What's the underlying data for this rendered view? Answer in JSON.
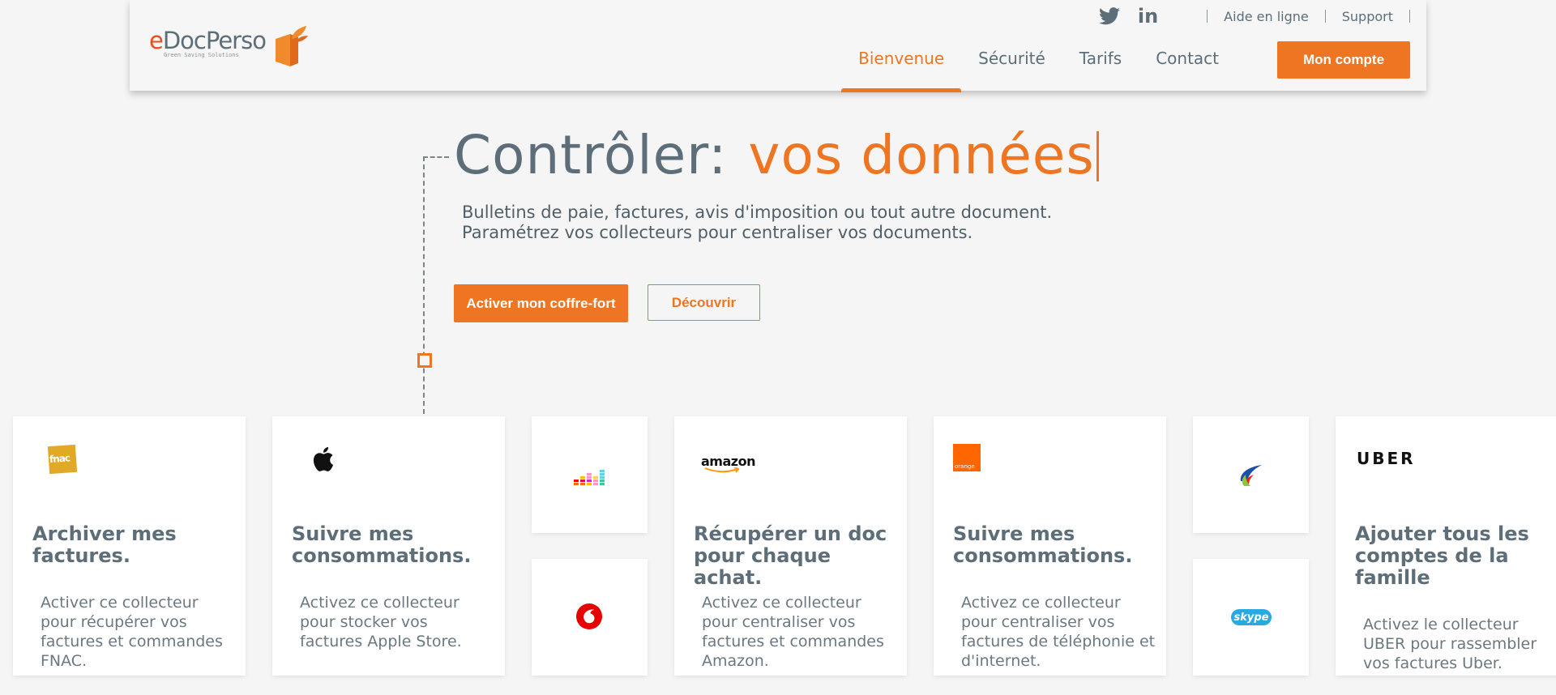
{
  "header": {
    "logo": {
      "text": "eDocPerso",
      "tagline": "Green Saving Solutions"
    },
    "social": [
      {
        "name": "twitter-icon"
      },
      {
        "name": "linkedin-icon",
        "label": "in"
      }
    ],
    "top_links": {
      "help": "Aide en ligne",
      "support": "Support"
    },
    "nav": [
      {
        "label": "Bienvenue",
        "active": true
      },
      {
        "label": "Sécurité",
        "active": false
      },
      {
        "label": "Tarifs",
        "active": false
      },
      {
        "label": "Contact",
        "active": false
      }
    ],
    "account_label": "Mon compte"
  },
  "hero": {
    "title_static": "Contrôler:",
    "title_dynamic": "vos données",
    "subtitle_line1": "Bulletins de paie, factures, avis d'imposition ou tout autre document.",
    "subtitle_line2": "Paramétrez vos collecteurs pour centraliser vos documents.",
    "primary_button": "Activer mon coffre-fort",
    "secondary_button": "Découvrir"
  },
  "cards": [
    {
      "logo": "fnac",
      "title": "Archiver mes factures.",
      "text": "Activer ce collecteur pour récupérer vos factures et commandes FNAC."
    },
    {
      "logo": "apple",
      "title": "Suivre mes consommations.",
      "text": "Activez ce collecteur pour stocker vos factures Apple Store."
    },
    {
      "logo": "deezer"
    },
    {
      "logo": "vodafone"
    },
    {
      "logo": "amazon",
      "title": "Récupérer un doc pour chaque achat.",
      "text": "Activez ce collecteur pour centraliser vos factures et commandes Amazon."
    },
    {
      "logo": "orange",
      "title": "Suivre mes consommations.",
      "text": "Activez ce collecteur pour centraliser vos factures de téléphonie et d'internet."
    },
    {
      "logo": "total"
    },
    {
      "logo": "skype"
    },
    {
      "logo": "uber",
      "title": "Ajouter tous les comptes de la famille",
      "text": "Activez le collecteur UBER pour rassembler vos factures Uber."
    }
  ],
  "logos": {
    "fnac": "fnac",
    "amazon": "amazon",
    "orange": "orange",
    "uber": "UBER",
    "skype": "skype"
  },
  "colors": {
    "accent": "#ee7623",
    "text": "#5d6e78",
    "background": "#f5f5f5"
  }
}
